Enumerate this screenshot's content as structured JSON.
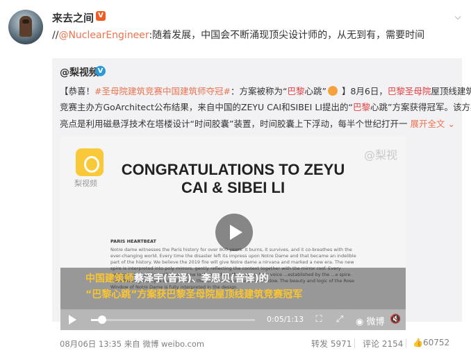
{
  "post": {
    "username": "来去之间",
    "verified_badge": "V",
    "text_prefix": "//",
    "mention": "@NuclearEngineer",
    "text_body": ":随着发展，中国会不断涌现顶尖设计师的，从无到有，需要时间"
  },
  "repost": {
    "username": "@梨视频",
    "verified_badge": "V",
    "line1_a": "【恭喜！",
    "line1_hashtag": "#圣母院建筑竞赛中国建筑师夺冠#",
    "line1_b": "：方案被称为“",
    "line1_red1": "巴黎",
    "line1_c": "心跳”",
    "line1_d": "】8月6日，",
    "line1_red2": "巴黎圣母院",
    "line1_e": "屋顶线建筑",
    "line2_a": "竞赛主办方GoArchitect公布结果，来自中国的ZEYU CAI和SIBEI LI提出的“",
    "line2_red": "巴黎",
    "line2_b": "心跳”方案获得冠军。该方案",
    "line3": "亮点是利用磁悬浮技术在塔楼设计“时间胶囊”装置，时间胶囊上下浮动，每半个世纪打开一",
    "expand": "展开全文",
    "expand_icon": "chevron-down-icon"
  },
  "video": {
    "app_name": "梨视频",
    "watermark": "@梨视",
    "headline_line1": "CONGRATULATIONS TO ZEYU",
    "headline_line2": "CAI & SIBEI LI",
    "section_title": "PARIS HEARTBEAT",
    "paragraph": "Notre dame witnesses the Paris history for over 800 years. It burns, it survives, and it co-breathes with the ever-changing world. Every time the disaster left its impress upon Notre Dame and that became an indelible part of the history. We believe the 2019 fire will give Notre dame a nirvana and marked a new era. The new spire is interpreted into poly mirrors, gently reflecting the context together with the mirror roof. Every moment, the building will have a new look, matching the... story. New voice ...established by the ...e spire. The vibrant glass dyes the light while the structure expresses the shadow. The beauty and logic of the Rose Window of Notre Dame is fully interpreted in the design.",
    "subtitle_line1_a": "中国建筑师",
    "subtitle_line1_b": "蔡泽宇(音译)、李思贝(音译)的",
    "subtitle_line2": "“巴黎心跳”方案获巴黎圣母院屋顶线建筑竞赛冠军",
    "time": "0:05/1:13",
    "progress": 0.07,
    "weibo_label": "微博"
  },
  "footer": {
    "timestamp": "08月06日 13:35 来自 微博 weibo.com",
    "repost_label": "转发 5971",
    "comment_label": "评论 2154",
    "like_count": "60752"
  },
  "colors": {
    "accent": "#eb7350",
    "highlight_red": "#e83c3c",
    "repost_bg": "#f2f2f5"
  }
}
